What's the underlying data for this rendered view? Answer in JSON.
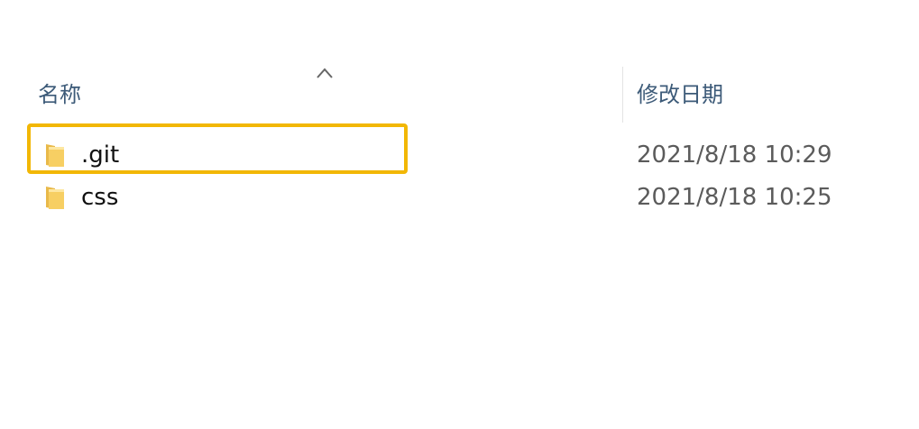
{
  "header": {
    "name_label": "名称",
    "date_label": "修改日期",
    "sort_icon": "chevron-up-icon"
  },
  "files": [
    {
      "name": ".git",
      "modified": "2021/8/18 10:29",
      "icon": "folder-icon",
      "highlighted": true
    },
    {
      "name": "css",
      "modified": "2021/8/18 10:25",
      "icon": "folder-icon",
      "highlighted": false
    }
  ],
  "colors": {
    "highlight": "#f2b705",
    "folder": "#f7cf63",
    "header_text": "#3c5a78"
  }
}
